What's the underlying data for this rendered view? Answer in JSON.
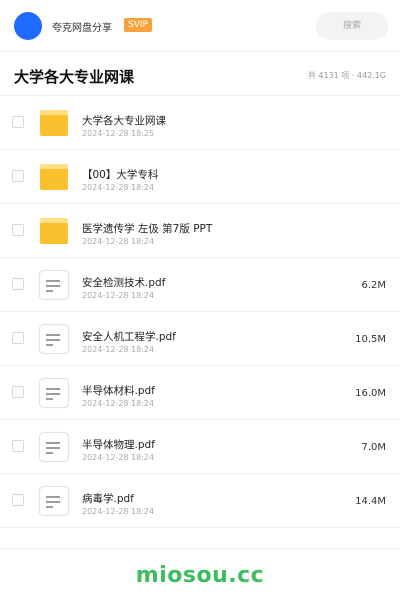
{
  "colors": {
    "avatar": "#1f6bff",
    "svip_badge": "#f7a23b",
    "folder": "#fbc02d",
    "folder_tab": "#ffe082",
    "doc_border": "#e2e2e2",
    "doc_lines": "#7a7a7a",
    "watermark": "#3dbd5e"
  },
  "header": {
    "share_name": "夸克网盘分享",
    "svip_label": "SVIP",
    "search_placeholder": "搜索"
  },
  "title_row": {
    "title": "大学各大专业网课",
    "summary": "共 4131 项 · 442.1G"
  },
  "files": [
    {
      "type": "folder-icon",
      "name": "大学各大专业网课",
      "date": "2024-12-28 18:25",
      "size": ""
    },
    {
      "type": "folder-icon",
      "name": "【00】大学专科",
      "date": "2024-12-28 18:24",
      "size": ""
    },
    {
      "type": "folder-icon",
      "name": "医学遗传学 左伋 第7版 PPT",
      "date": "2024-12-28 18:24",
      "size": ""
    },
    {
      "type": "document-icon",
      "name": "安全检测技术.pdf",
      "date": "2024-12-28 18:24",
      "size": "6.2M"
    },
    {
      "type": "document-icon",
      "name": "安全人机工程学.pdf",
      "date": "2024-12-28 18:24",
      "size": "10.5M"
    },
    {
      "type": "document-icon",
      "name": "半导体材料.pdf",
      "date": "2024-12-28 18:24",
      "size": "16.0M"
    },
    {
      "type": "document-icon",
      "name": "半导体物理.pdf",
      "date": "2024-12-28 18:24",
      "size": "7.0M"
    },
    {
      "type": "document-icon",
      "name": "病毒学.pdf",
      "date": "2024-12-28 18:24",
      "size": "14.4M"
    }
  ],
  "footer": {
    "watermark": "miosou.cc"
  }
}
